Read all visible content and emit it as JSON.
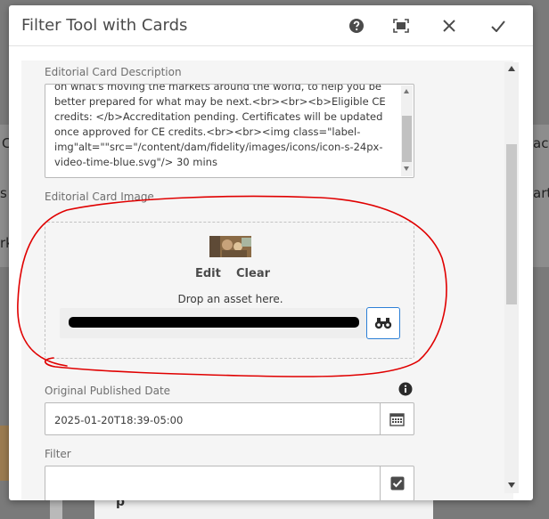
{
  "background": {
    "fragments": [
      "C",
      "act",
      "s",
      "arte",
      "rk"
    ],
    "bottom_text": "p"
  },
  "dialog": {
    "title": "Filter Tool with Cards",
    "icons": {
      "help": "help-icon",
      "fullscreen": "fullscreen-icon",
      "close": "close-icon",
      "done": "checkmark-icon"
    }
  },
  "form": {
    "description": {
      "label": "Editorial Card Description",
      "value": "on what's moving the markets around the world, to help you be better prepared for what may be next.<br><br><b>Eligible CE credits: </b>Accreditation pending. Certificates will be updated once approved for CE credits.<br><br><img class=\"label-img\"alt=\"\"src=\"/content/dam/fidelity/images/icons/icon-s-24px-video-time-blue.svg\"/> 30 mins"
    },
    "image": {
      "label": "Editorial Card Image",
      "edit_label": "Edit",
      "clear_label": "Clear",
      "drop_text": "Drop an asset here.",
      "browse_icon": "binoculars-icon"
    },
    "published_date": {
      "label": "Original Published Date",
      "value": "2025-01-20T18:39-05:00",
      "info_icon": "info-icon",
      "calendar_icon": "calendar-icon"
    },
    "filter": {
      "label": "Filter",
      "value": "",
      "icon": "checkbox-checked-icon"
    }
  },
  "colors": {
    "accent": "#2c7fd6",
    "annotation": "#e00000"
  }
}
